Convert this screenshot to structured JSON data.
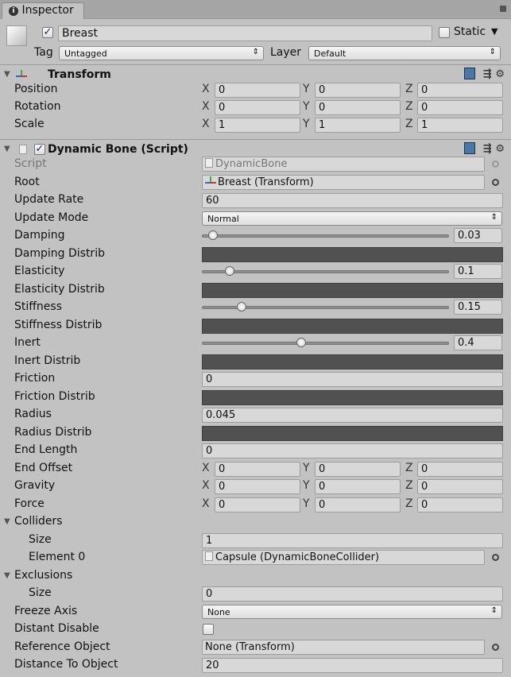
{
  "tab": {
    "title": "Inspector"
  },
  "object": {
    "active": true,
    "name": "Breast",
    "static_label": "Static",
    "static": false,
    "tag_label": "Tag",
    "tag": "Untagged",
    "layer_label": "Layer",
    "layer": "Default"
  },
  "transform": {
    "title": "Transform",
    "rows": [
      {
        "label": "Position",
        "x": "0",
        "y": "0",
        "z": "0"
      },
      {
        "label": "Rotation",
        "x": "0",
        "y": "0",
        "z": "0"
      },
      {
        "label": "Scale",
        "x": "1",
        "y": "1",
        "z": "1"
      }
    ]
  },
  "axis_labels": {
    "x": "X",
    "y": "Y",
    "z": "Z"
  },
  "dynamic_bone": {
    "title": "Dynamic Bone (Script)",
    "enabled": true,
    "rows": [
      {
        "type": "object",
        "label": "Script",
        "value": "DynamicBone",
        "icon": "script-icon",
        "disabled": true
      },
      {
        "type": "object",
        "label": "Root",
        "value": "Breast (Transform)",
        "icon": "transform-icon"
      },
      {
        "type": "text",
        "label": "Update Rate",
        "value": "60"
      },
      {
        "type": "dropdown",
        "label": "Update Mode",
        "value": "Normal"
      },
      {
        "type": "slider",
        "label": "Damping",
        "value": "0.03",
        "fraction": 0.03
      },
      {
        "type": "curve",
        "label": "Damping Distrib"
      },
      {
        "type": "slider",
        "label": "Elasticity",
        "value": "0.1",
        "fraction": 0.1
      },
      {
        "type": "curve",
        "label": "Elasticity Distrib"
      },
      {
        "type": "slider",
        "label": "Stiffness",
        "value": "0.15",
        "fraction": 0.15
      },
      {
        "type": "curve",
        "label": "Stiffness Distrib"
      },
      {
        "type": "slider",
        "label": "Inert",
        "value": "0.4",
        "fraction": 0.4
      },
      {
        "type": "curve",
        "label": "Inert Distrib"
      },
      {
        "type": "text",
        "label": "Friction",
        "value": "0"
      },
      {
        "type": "curve",
        "label": "Friction Distrib"
      },
      {
        "type": "text",
        "label": "Radius",
        "value": "0.045"
      },
      {
        "type": "curve",
        "label": "Radius Distrib"
      },
      {
        "type": "text",
        "label": "End Length",
        "value": "0"
      },
      {
        "type": "vec3",
        "label": "End Offset",
        "x": "0",
        "y": "0",
        "z": "0"
      },
      {
        "type": "vec3",
        "label": "Gravity",
        "x": "0",
        "y": "0",
        "z": "0"
      },
      {
        "type": "vec3",
        "label": "Force",
        "x": "0",
        "y": "0",
        "z": "0"
      },
      {
        "type": "foldout",
        "label": "Colliders"
      },
      {
        "type": "text",
        "label": "Size",
        "value": "1",
        "indent": true
      },
      {
        "type": "object",
        "label": "Element 0",
        "value": "Capsule (DynamicBoneCollider)",
        "icon": "script-icon",
        "indent": true
      },
      {
        "type": "foldout",
        "label": "Exclusions"
      },
      {
        "type": "text",
        "label": "Size",
        "value": "0",
        "indent": true
      },
      {
        "type": "dropdown",
        "label": "Freeze Axis",
        "value": "None"
      },
      {
        "type": "checkbox",
        "label": "Distant Disable",
        "checked": false
      },
      {
        "type": "object",
        "label": "Reference Object",
        "value": "None (Transform)"
      },
      {
        "type": "text",
        "label": "Distance To Object",
        "value": "20"
      }
    ]
  }
}
